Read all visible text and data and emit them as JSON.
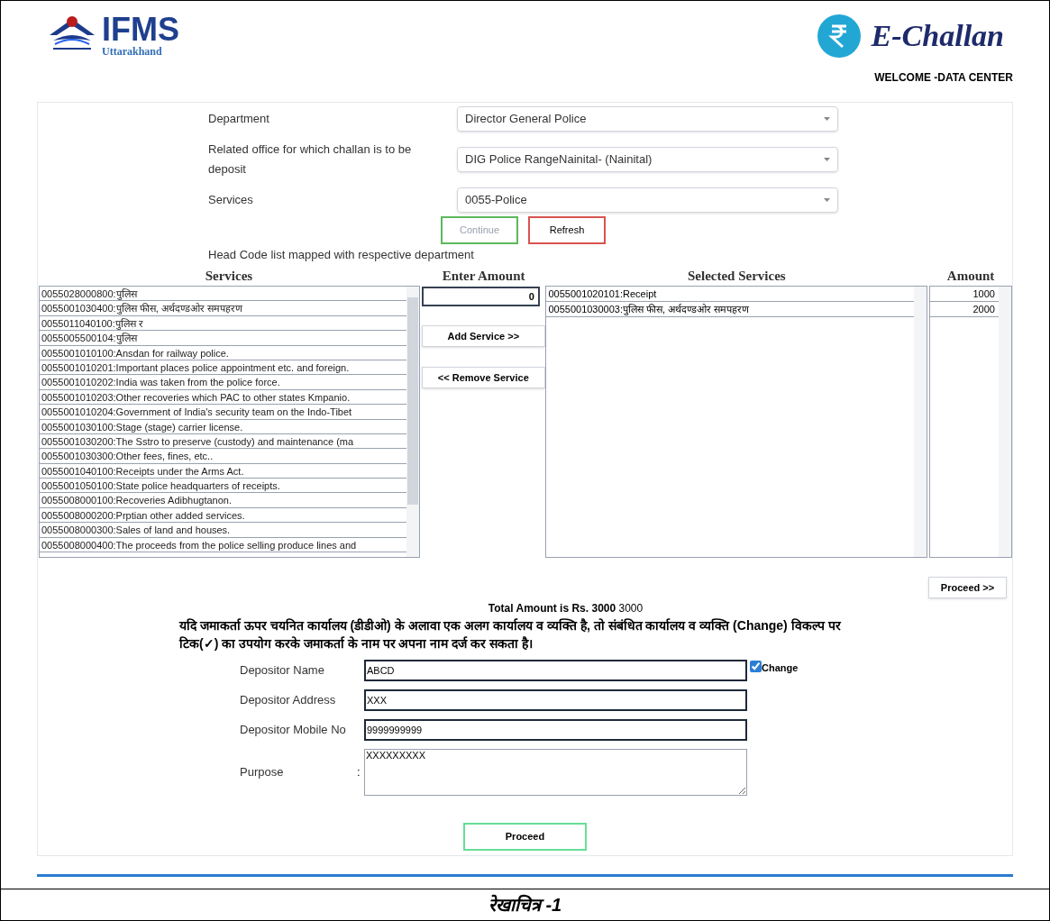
{
  "header": {
    "logo_title": "IFMS",
    "logo_subtitle": "Uttarakhand",
    "brand": "E-Challan",
    "welcome": "WELCOME -DATA CENTER"
  },
  "selects": [
    {
      "label": "Department",
      "value": "Director General Police"
    },
    {
      "label": "Related office for which challan is to be deposit",
      "value": "DIG Police RangeNainital- (Nainital)"
    },
    {
      "label": "Services",
      "value": "0055-Police"
    }
  ],
  "buttons": [
    {
      "label": "Continue",
      "disabled": true,
      "color": "#5cb85c"
    },
    {
      "label": "Refresh",
      "disabled": false,
      "color": "#d9534f"
    }
  ],
  "head_code_note": "Head Code list mapped with respective department",
  "services": {
    "heading": "Services",
    "items": [
      "0055028000800:पुलिस",
      "0055001030400:पुलिस फीस, अर्थदण्डओर समपहरण",
      "0055011040100:पुलिस र",
      "0055005500104:पुलिस",
      "0055001010100:Ansdan for railway police.",
      "0055001010201:Important places police appointment etc. and foreign.",
      "0055001010202:India was taken from the police force.",
      "0055001010203:Other recoveries which PAC to other states Kmpanio.",
      "0055001010204:Government of India's security team on the Indo-Tibet",
      "0055001030100:Stage (stage) carrier license.",
      "0055001030200:The Sstro to preserve (custody) and maintenance (ma",
      "0055001030300:Other fees, fines, etc..",
      "0055001040100:Receipts under the Arms Act.",
      "0055001050100:State police headquarters of receipts.",
      "0055008000100:Recoveries Adibhugtanon.",
      "0055008000200:Prptian other added services.",
      "0055008000300:Sales of land and houses.",
      "0055008000400:The proceeds from the police selling produce lines and"
    ]
  },
  "enter_amount": {
    "heading": "Enter Amount",
    "value": "0",
    "add_button": "Add Service >>",
    "remove_button": "<< Remove Service"
  },
  "selected_services": {
    "heading": "Selected Services",
    "amount_heading": "Amount",
    "items": [
      {
        "service": "0055001020101:Receipt",
        "amount": "1000"
      },
      {
        "service": "0055001030003:पुलिस फीस, अर्थदण्डओर समपहरण",
        "amount": "2000"
      }
    ]
  },
  "proceed_small": "Proceed >>",
  "total": "**Total Amount is Rs. 3000** 3000",
  "notice": "यदि जमाकर्ता ऊपर चयनित कार्यालय (डीडीओ) के अलावा एक अलग कार्यालय व व्यक्ति है, तो संबंधित कार्यालय व व्यक्ति (Change) विकल्प पर टिक(✓) का उपयोग करके जमाकर्ता के नाम पर अपना नाम दर्ज कर सकता है।",
  "depositor": [
    {
      "kind": "input",
      "label": "Depositor Name",
      "value": "ABCD"
    },
    {
      "kind": "input",
      "label": "Depositor Address",
      "value": "XXX"
    },
    {
      "kind": "input",
      "label": "Depositor Mobile No",
      "value": "9999999999"
    },
    {
      "kind": "textarea",
      "label": "Purpose",
      "separator": ":",
      "value": "XXXXXXXXX"
    }
  ],
  "change": {
    "label": "Change",
    "checked": true
  },
  "proceed": "Proceed",
  "caption": "रेखाचित्र -1"
}
